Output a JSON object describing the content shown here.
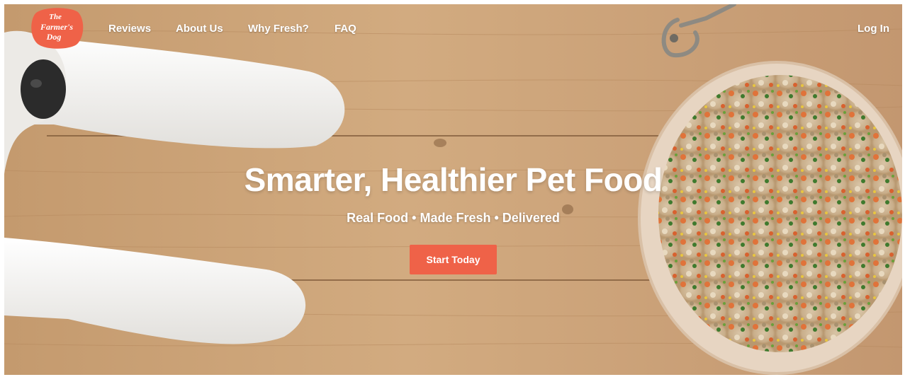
{
  "brand": {
    "logo_text": "The Farmer's Dog",
    "color": "#ef6248"
  },
  "nav": {
    "links": [
      {
        "label": "Reviews"
      },
      {
        "label": "About Us"
      },
      {
        "label": "Why Fresh?"
      },
      {
        "label": "FAQ"
      }
    ],
    "login": "Log In"
  },
  "hero": {
    "headline": "Smarter, Healthier Pet Food",
    "subheadline": "Real Food • Made Fresh • Delivered",
    "cta": "Start Today",
    "cta_color": "#ef6248"
  }
}
